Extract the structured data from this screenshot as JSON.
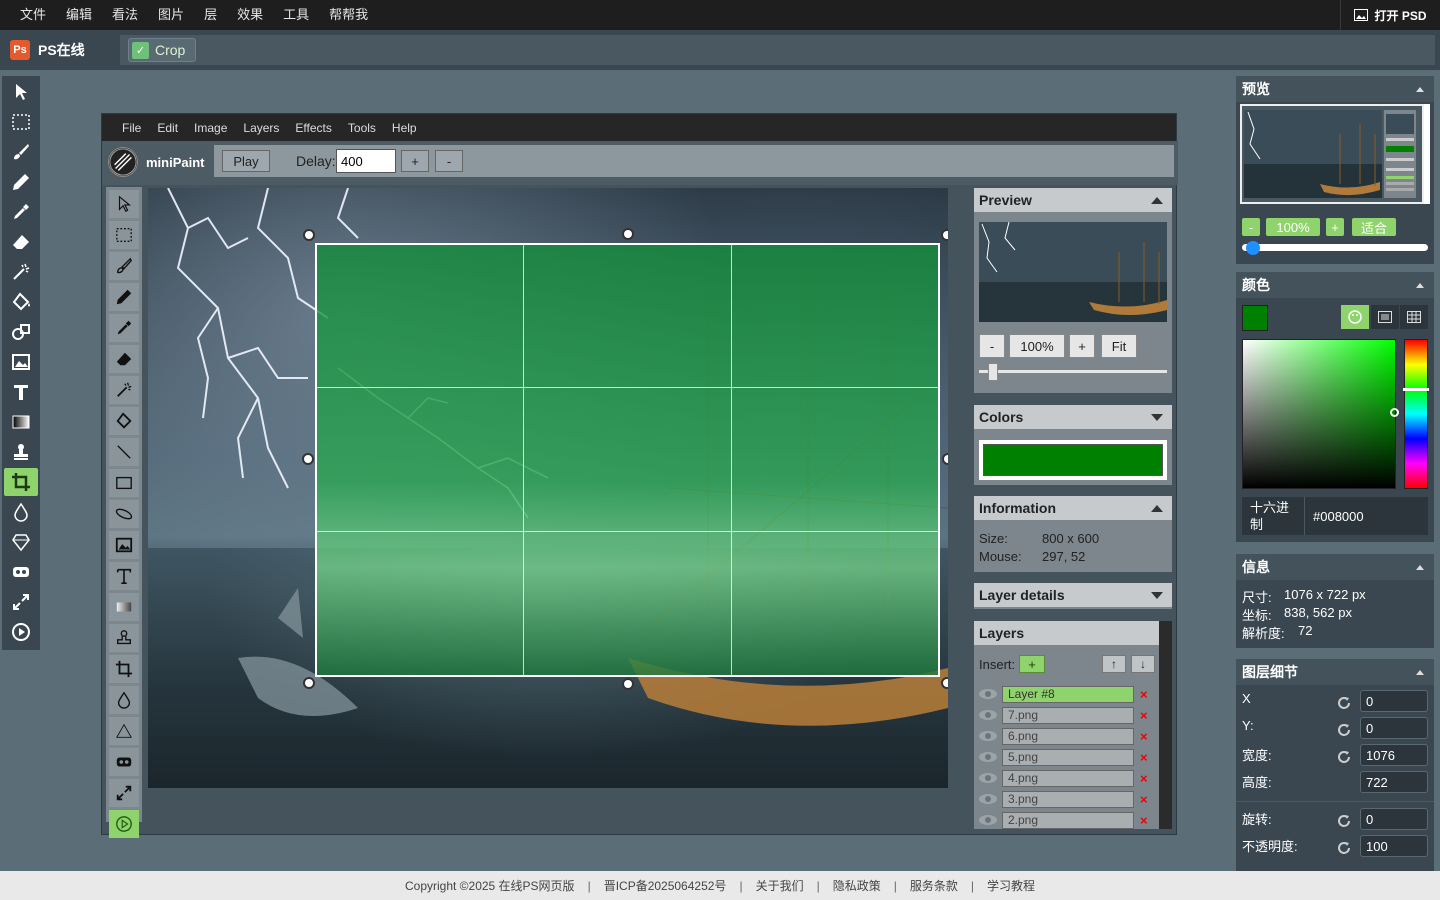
{
  "top_menu": [
    "文件",
    "编辑",
    "看法",
    "图片",
    "层",
    "效果",
    "工具",
    "帮帮我"
  ],
  "open_psd_label": "打开 PSD",
  "logo": {
    "badge": "Ps",
    "text": "PS在线"
  },
  "crop_tool": {
    "label": "Crop",
    "check": "✓"
  },
  "outer_tools": [
    "pointer-icon",
    "rect-select-icon",
    "brush-icon",
    "pencil-icon",
    "pipette-icon",
    "eraser-icon",
    "magic-wand-icon",
    "fill-icon",
    "shape-icon",
    "image-icon",
    "text-icon",
    "gradient-icon",
    "stamp-icon",
    "crop-icon",
    "blur-icon",
    "sharpen-icon",
    "bulge-icon",
    "resize-icon",
    "animation-icon"
  ],
  "minipaint": {
    "menu": [
      "File",
      "Edit",
      "Image",
      "Layers",
      "Effects",
      "Tools",
      "Help"
    ],
    "logo_text": "miniPaint",
    "play_label": "Play",
    "delay_label": "Delay:",
    "delay_value": "400",
    "plus": "+",
    "minus": "-",
    "preview": {
      "title": "Preview",
      "zoom": "100%",
      "fit": "Fit",
      "minus": "-",
      "plus": "+"
    },
    "colors": {
      "title": "Colors",
      "current": "#008000"
    },
    "information": {
      "title": "Information",
      "size_label": "Size:",
      "size_value": "800 x 600",
      "mouse_label": "Mouse:",
      "mouse_value": "297, 52"
    },
    "layer_details": {
      "title": "Layer details"
    },
    "layers": {
      "title": "Layers",
      "insert_label": "Insert:",
      "insert_btn": "+",
      "up": "↑",
      "down": "↓",
      "items": [
        {
          "name": "Layer #8",
          "active": true
        },
        {
          "name": "7.png",
          "active": false
        },
        {
          "name": "6.png",
          "active": false
        },
        {
          "name": "5.png",
          "active": false
        },
        {
          "name": "4.png",
          "active": false
        },
        {
          "name": "3.png",
          "active": false
        },
        {
          "name": "2.png",
          "active": false
        }
      ],
      "delete": "×"
    }
  },
  "right": {
    "preview": {
      "title": "预览",
      "minus": "-",
      "zoom": "100%",
      "plus": "+",
      "fit": "适合"
    },
    "color": {
      "title": "颜色",
      "hex_label": "十六进制",
      "hex_value": "#008000",
      "swatch": "#008000"
    },
    "info": {
      "title": "信息",
      "size_label": "尺寸:",
      "size_value": "1076 x 722 px",
      "coord_label": "坐标:",
      "coord_value": "838, 562 px",
      "res_label": "解析度:",
      "res_value": "72"
    },
    "layer_detail": {
      "title": "图层细节",
      "x_label": "X",
      "x_value": "0",
      "y_label": "Y:",
      "y_value": "0",
      "w_label": "宽度:",
      "w_value": "1076",
      "h_label": "高度:",
      "h_value": "722",
      "rot_label": "旋转:",
      "rot_value": "0",
      "op_label": "不透明度:",
      "op_value": "100"
    }
  },
  "footer": [
    "Copyright ©2025 在线PS网页版",
    "晋ICP备2025064252号",
    "关于我们",
    "隐私政策",
    "服务条款",
    "学习教程"
  ]
}
